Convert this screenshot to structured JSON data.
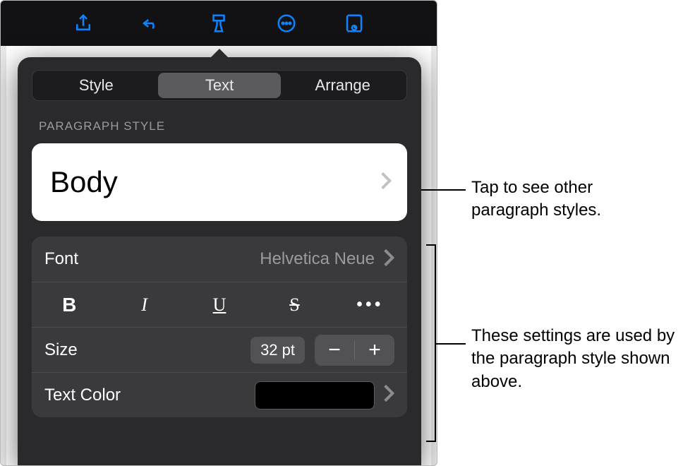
{
  "toolbar": {
    "icons": [
      "share-icon",
      "undo-icon",
      "format-brush-icon",
      "more-icon",
      "presenter-icon"
    ]
  },
  "tabs": {
    "items": [
      "Style",
      "Text",
      "Arrange"
    ],
    "active_index": 1
  },
  "section_label": "PARAGRAPH STYLE",
  "paragraph_style": {
    "name": "Body"
  },
  "font": {
    "label": "Font",
    "value": "Helvetica Neue"
  },
  "format_buttons": {
    "bold": "B",
    "italic": "I",
    "underline": "U",
    "strike": "S",
    "more": "•••"
  },
  "size": {
    "label": "Size",
    "value": "32 pt",
    "minus": "−",
    "plus": "+"
  },
  "text_color": {
    "label": "Text Color",
    "swatch": "#000000"
  },
  "callouts": {
    "style": "Tap to see other paragraph styles.",
    "settings": "These settings are used by the paragraph style shown above."
  }
}
